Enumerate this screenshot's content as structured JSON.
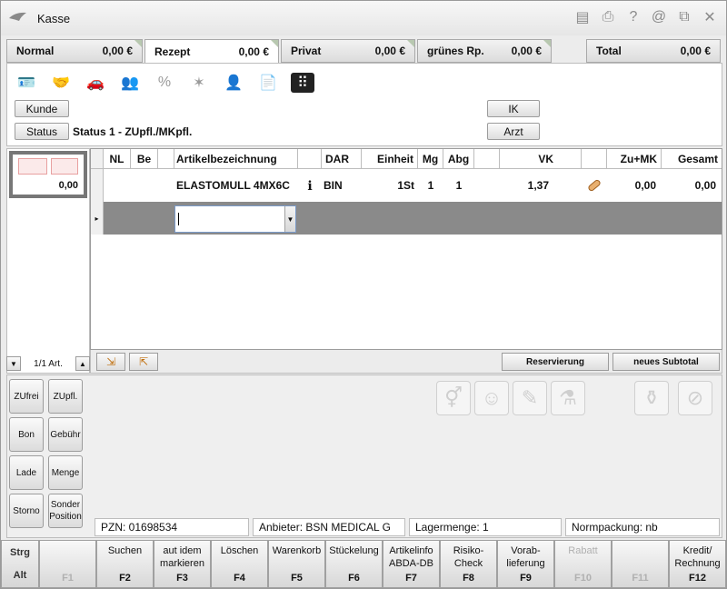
{
  "window": {
    "title": "Kasse"
  },
  "title_icons": [
    "document-icon",
    "print-icon",
    "help-icon",
    "at-icon",
    "window-icon",
    "close-icon"
  ],
  "tabs": [
    {
      "name": "Normal",
      "value": "0,00 €"
    },
    {
      "name": "Rezept",
      "value": "0,00 €"
    },
    {
      "name": "Privat",
      "value": "0,00 €"
    },
    {
      "name": "grünes Rp.",
      "value": "0,00 €"
    }
  ],
  "total": {
    "name": "Total",
    "value": "0,00 €"
  },
  "top": {
    "kunde_label": "Kunde",
    "status_label": "Status",
    "status_text": "Status 1 - ZUpfl./MKpfl.",
    "ik_label": "IK",
    "arzt_label": "Arzt"
  },
  "receipt": {
    "value": "0,00"
  },
  "pager": {
    "label": "1/1 Art."
  },
  "grid": {
    "headers": [
      "NL",
      "Be",
      "Artikelbezeichnung",
      "DAR",
      "Einheit",
      "Mg",
      "Abg",
      "VK",
      "Zu+MK",
      "Gesamt"
    ],
    "row": {
      "artikel": "ELASTOMULL 4MX6C",
      "dar": "BIN",
      "einheit": "1St",
      "mg": "1",
      "abg": "1",
      "vk": "1,37",
      "zumk": "0,00",
      "gesamt": "0,00"
    }
  },
  "grid_buttons": {
    "reservierung": "Reservierung",
    "subtotal": "neues Subtotal"
  },
  "side_buttons": [
    [
      "ZUfrei",
      "ZUpfl."
    ],
    [
      "Bon",
      "Gebühr"
    ],
    [
      "Lade",
      "Menge"
    ],
    [
      "Storno",
      "Sonder Position"
    ]
  ],
  "info": {
    "pzn": "PZN: 01698534",
    "anbieter": "Anbieter: BSN MEDICAL G",
    "lagermenge": "Lagermenge: 1",
    "normpackung": "Normpackung: nb"
  },
  "fmods": [
    "Strg",
    "Alt"
  ],
  "fkeys": [
    {
      "label": "",
      "key": "F1",
      "enabled": false
    },
    {
      "label": "Suchen",
      "key": "F2",
      "enabled": true
    },
    {
      "label": "aut idem markieren",
      "key": "F3",
      "enabled": true
    },
    {
      "label": "Löschen",
      "key": "F4",
      "enabled": true
    },
    {
      "label": "Warenkorb",
      "key": "F5",
      "enabled": true
    },
    {
      "label": "Stückelung",
      "key": "F6",
      "enabled": true
    },
    {
      "label": "Artikelinfo ABDA-DB",
      "key": "F7",
      "enabled": true
    },
    {
      "label": "Risiko-Check",
      "key": "F8",
      "enabled": true
    },
    {
      "label": "Vorab-lieferung",
      "key": "F9",
      "enabled": true
    },
    {
      "label": "Rabatt",
      "key": "F10",
      "enabled": false
    },
    {
      "label": "",
      "key": "F11",
      "enabled": false
    },
    {
      "label": "Kredit/ Rechnung",
      "key": "F12",
      "enabled": true
    }
  ]
}
